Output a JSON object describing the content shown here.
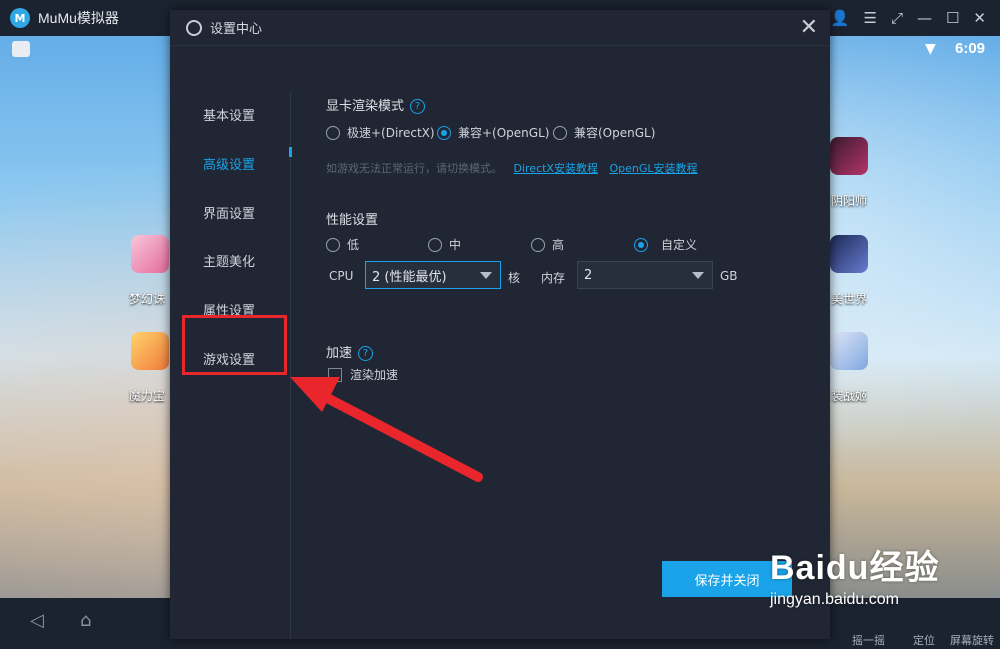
{
  "emulator": {
    "app_title": "MuMu模拟器",
    "clock": "6:09",
    "apps": [
      {
        "label": "梦幻诛"
      },
      {
        "label": "魔力宝"
      },
      {
        "label": "阴阳师"
      },
      {
        "label": "美世界"
      },
      {
        "label": "装战姬"
      }
    ],
    "nav_labels": [
      "定位",
      "屏幕旋转",
      "摇一摇"
    ]
  },
  "dialog": {
    "title": "设置中心",
    "sidebar": [
      {
        "label": "基本设置",
        "active": false
      },
      {
        "label": "高级设置",
        "active": true
      },
      {
        "label": "界面设置",
        "active": false
      },
      {
        "label": "主题美化",
        "active": false
      },
      {
        "label": "属性设置",
        "active": false
      },
      {
        "label": "游戏设置",
        "active": false
      }
    ],
    "gpu": {
      "title": "显卡渲染模式",
      "options": [
        "极速+(DirectX)",
        "兼容+(OpenGL)",
        "兼容(OpenGL)"
      ],
      "selected_index": 1,
      "hint": "如游戏无法正常运行，请切换模式。",
      "link_directx": "DirectX安装教程",
      "link_opengl": "OpenGL安装教程"
    },
    "performance": {
      "title": "性能设置",
      "options": [
        "低",
        "中",
        "高",
        "自定义"
      ],
      "selected_index": 3,
      "cpu_label": "CPU",
      "cpu_value": "2 (性能最优)",
      "cpu_unit": "核",
      "mem_label": "内存",
      "mem_value": "2",
      "mem_unit": "GB"
    },
    "accel": {
      "title": "加速",
      "checkbox_label": "渲染加速",
      "checked": false
    },
    "save_label": "保存并关闭"
  },
  "watermark": {
    "brand": "Baidu经验",
    "url": "jingyan.baidu.com"
  },
  "colors": {
    "accent": "#1aa3e8",
    "annotation": "#e8262c",
    "dialog_bg": "#202633"
  }
}
